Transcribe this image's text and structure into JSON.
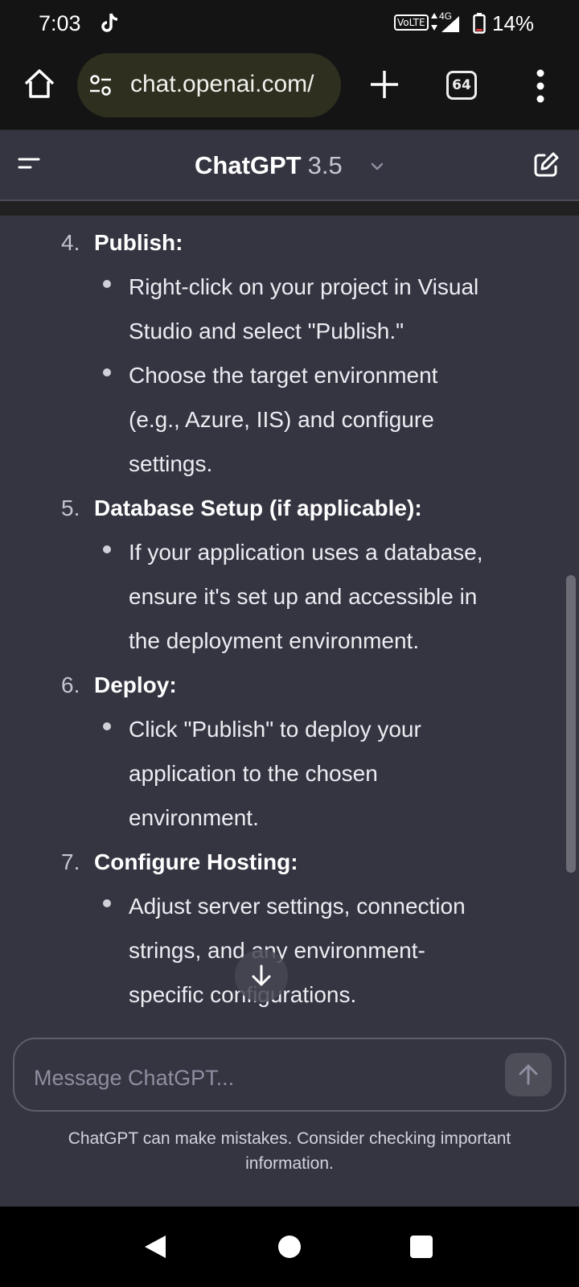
{
  "status_bar": {
    "time": "7:03",
    "volte_label": "VoLTE",
    "network_type": "4G",
    "battery_percent": "14%"
  },
  "browser": {
    "url": "chat.openai.com/",
    "tab_count": "64"
  },
  "header": {
    "title": "ChatGPT",
    "version": "3.5"
  },
  "content": {
    "steps": [
      {
        "number": "4.",
        "title": "Publish:",
        "bullets": [
          [
            "Right-click on your project in Visual",
            "Studio and select \"Publish.\""
          ],
          [
            "Choose the target environment",
            "(e.g., Azure, IIS) and configure",
            "settings."
          ]
        ]
      },
      {
        "number": "5.",
        "title": "Database Setup (if applicable):",
        "bullets": [
          [
            "If your application uses a database,",
            "ensure it's set up and accessible in",
            "the deployment environment."
          ]
        ]
      },
      {
        "number": "6.",
        "title": "Deploy:",
        "bullets": [
          [
            "Click \"Publish\" to deploy your",
            "application to the chosen",
            "environment."
          ]
        ]
      },
      {
        "number": "7.",
        "title": "Configure Hosting:",
        "bullets": [
          [
            "Adjust server settings, connection",
            "strings, and any environment-",
            "specific configurations."
          ]
        ]
      }
    ]
  },
  "composer": {
    "placeholder": "Message ChatGPT..."
  },
  "disclaimer": "ChatGPT can make mistakes. Consider checking important information."
}
